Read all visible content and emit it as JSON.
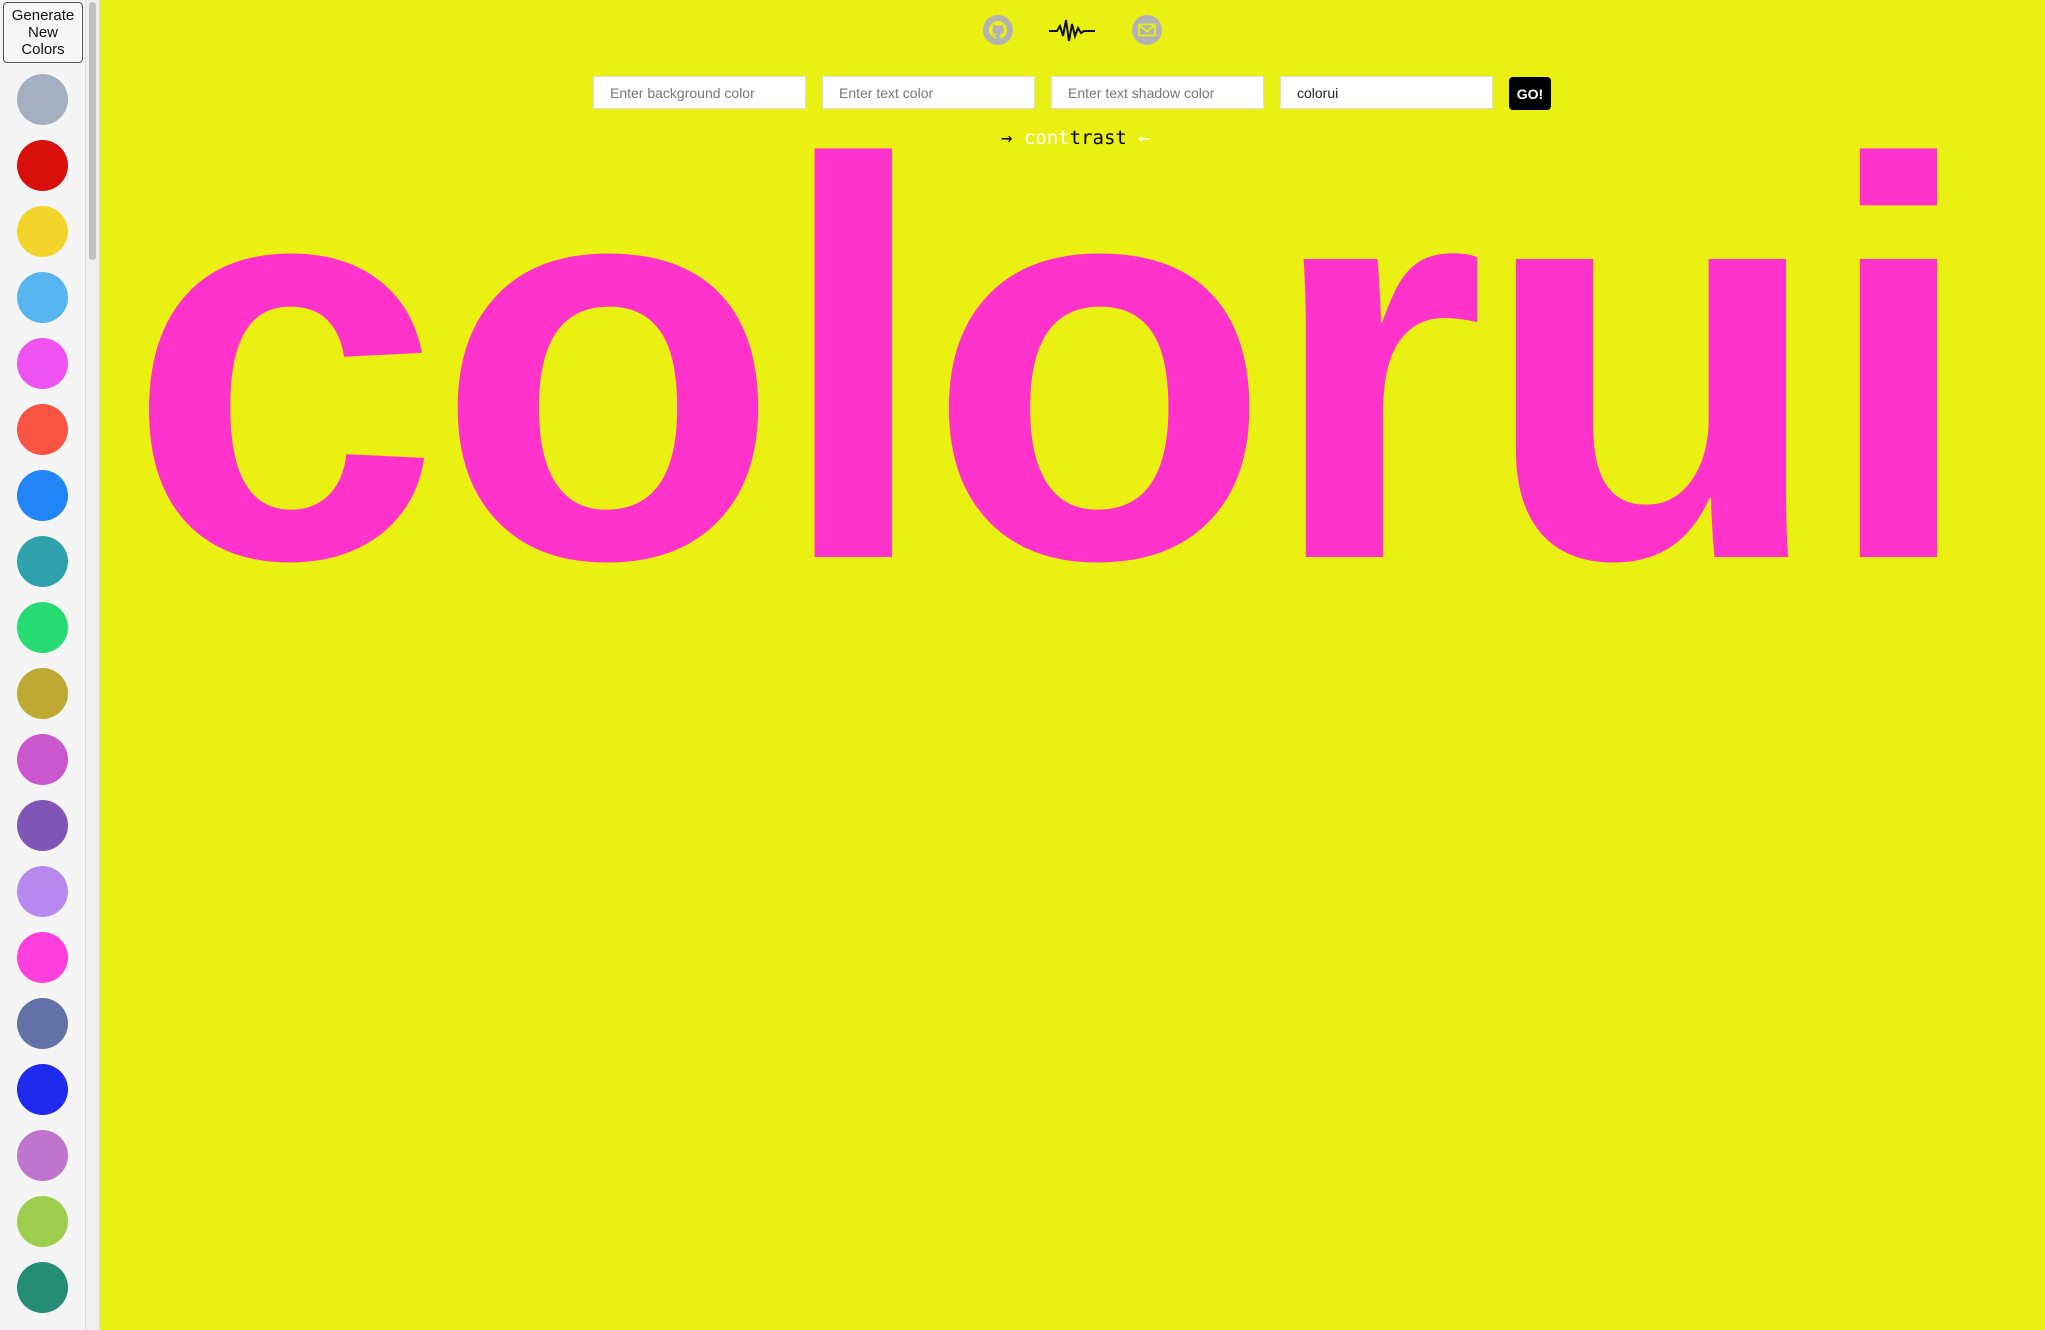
{
  "sidebar": {
    "generate_label": "Generate\nNew\nColors",
    "swatches": [
      "#a4b0bf",
      "#d90f0b",
      "#f3d42b",
      "#56b4ee",
      "#ee52f0",
      "#f95443",
      "#2185f8",
      "#2ea1ad",
      "#25db72",
      "#bda832",
      "#cb57cc",
      "#8055b5",
      "#b788ee",
      "#ff3edd",
      "#6272a6",
      "#2029ee",
      "#bf75cd",
      "#9fce4e",
      "#258d75"
    ]
  },
  "toolbar": {
    "icons": [
      "github-icon",
      "pulse-icon",
      "mail-icon"
    ],
    "background_placeholder": "Enter background color",
    "text_color_placeholder": "Enter text color",
    "shadow_placeholder": "Enter text shadow color",
    "text_value": "colorui",
    "go_label": "GO!"
  },
  "contrast": {
    "arrow_left": "→",
    "part_light": "cont",
    "part_dark": "trast",
    "arrow_right": "←"
  },
  "preview": {
    "word": "colorui"
  },
  "colors": {
    "background": "#e9f012",
    "text": "#ff33cc"
  }
}
